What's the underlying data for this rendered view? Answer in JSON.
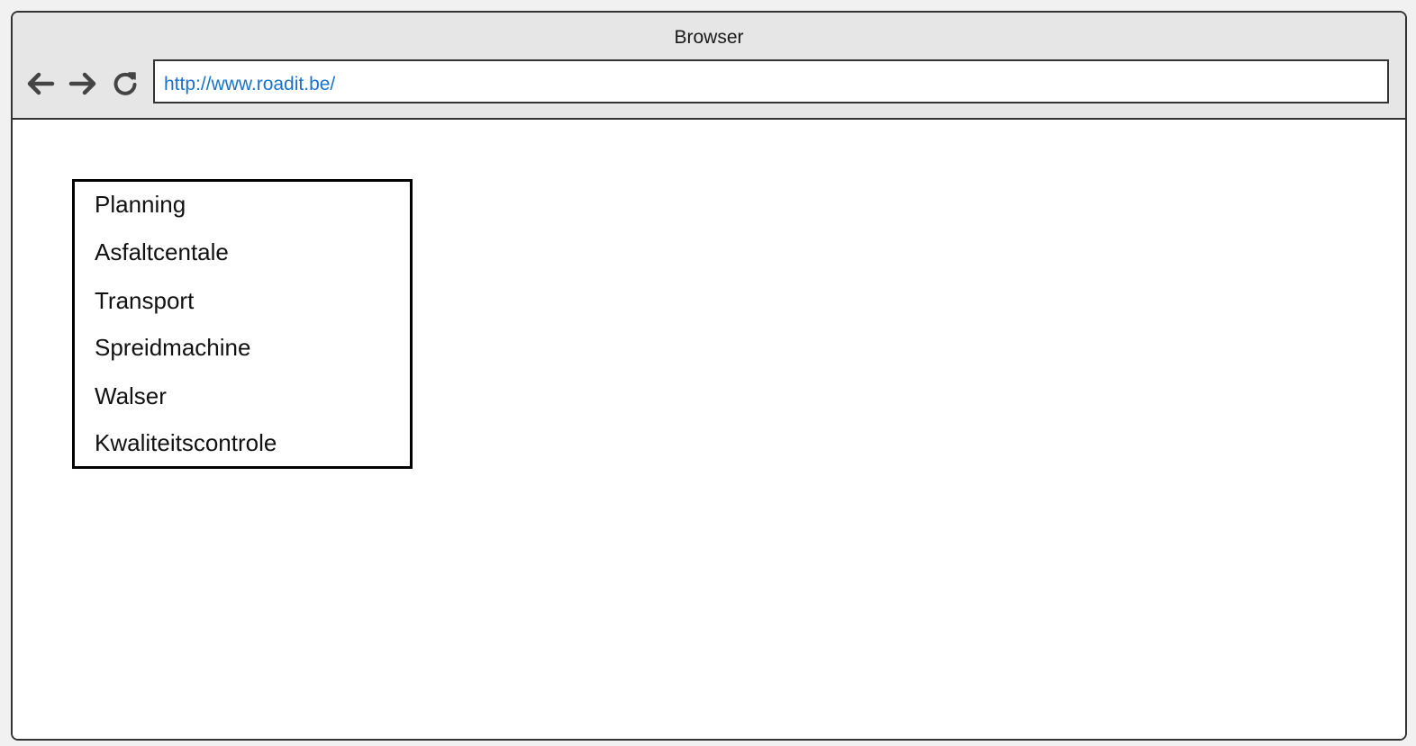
{
  "browser": {
    "title": "Browser",
    "url": "http://www.roadit.be/",
    "icons": {
      "back": "arrow-left-icon",
      "forward": "arrow-right-icon",
      "reload": "reload-icon"
    }
  },
  "menu": {
    "items": [
      {
        "label": "Planning"
      },
      {
        "label": "Asfaltcentale"
      },
      {
        "label": "Transport"
      },
      {
        "label": "Spreidmachine"
      },
      {
        "label": "Walser"
      },
      {
        "label": "Kwaliteitscontrole"
      }
    ]
  },
  "colors": {
    "chrome": "#e6e6e6",
    "border": "#333333",
    "url_text": "#1a73c9",
    "icon": "#444444"
  }
}
